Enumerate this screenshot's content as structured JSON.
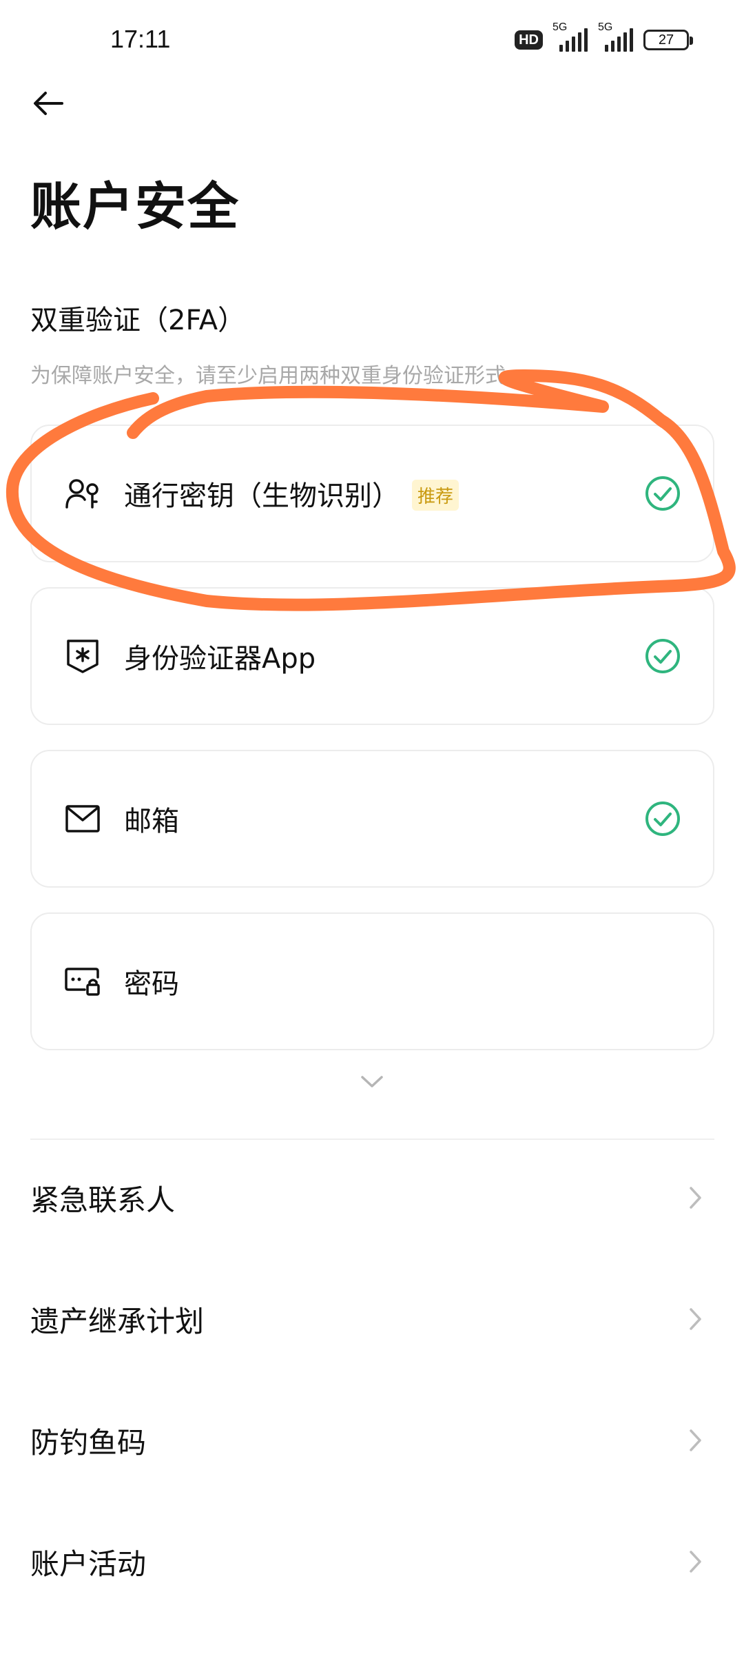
{
  "status_bar": {
    "time": "17:11",
    "hd_label": "HD",
    "network_1": "5G",
    "network_2": "5G",
    "battery": "27"
  },
  "page": {
    "title": "账户安全"
  },
  "two_fa": {
    "title": "双重验证（2FA）",
    "description": "为保障账户安全，请至少启用两种双重身份验证形式",
    "items": [
      {
        "label": "通行密钥（生物识别）",
        "badge": "推荐",
        "icon": "passkey-icon",
        "enabled": true
      },
      {
        "label": "身份验证器App",
        "icon": "authenticator-icon",
        "enabled": true
      },
      {
        "label": "邮箱",
        "icon": "mail-icon",
        "enabled": true
      },
      {
        "label": "密码",
        "icon": "password-icon",
        "enabled": false
      }
    ]
  },
  "menu": [
    {
      "label": "紧急联系人"
    },
    {
      "label": "遗产继承计划"
    },
    {
      "label": "防钓鱼码"
    },
    {
      "label": "账户活动"
    }
  ],
  "colors": {
    "check_green": "#2fb57e",
    "badge_bg": "#fff5d1",
    "badge_text": "#c99a10",
    "annotation": "#ff7a3d"
  }
}
